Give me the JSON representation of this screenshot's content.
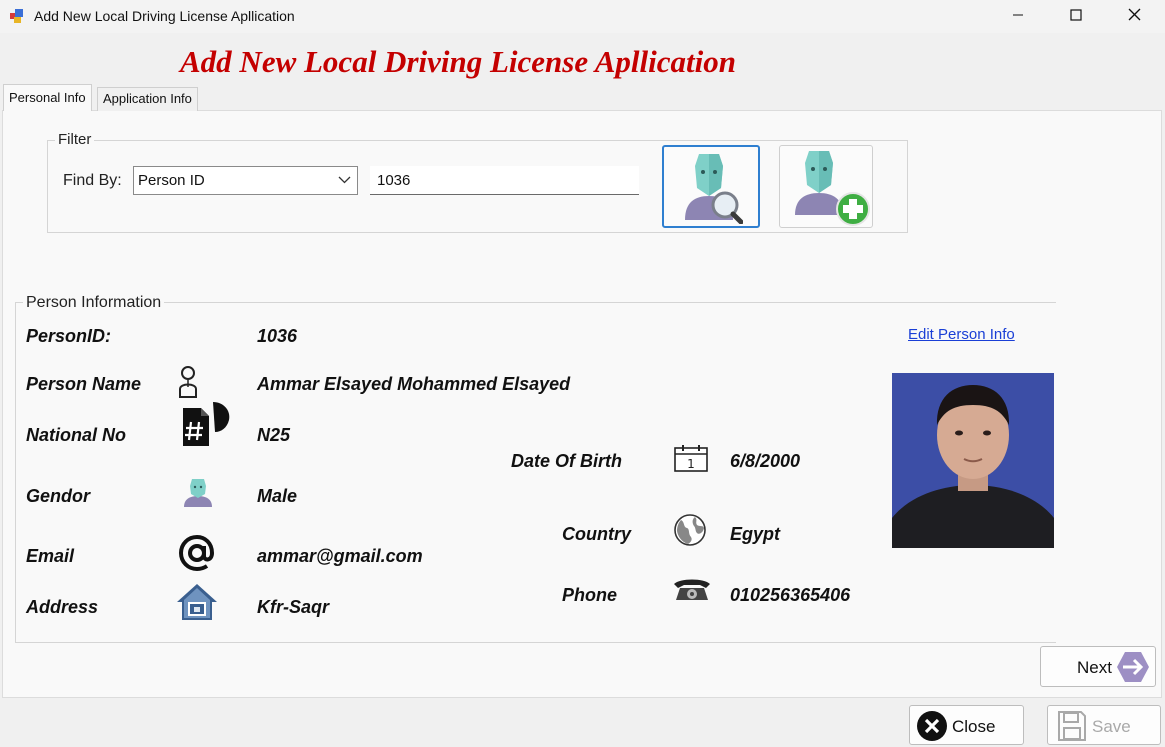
{
  "window": {
    "title": "Add New Local Driving License Apllication",
    "app_icon": "form-icon",
    "minimize_icon": "minimize-icon",
    "maximize_icon": "maximize-icon",
    "close_icon": "close-icon"
  },
  "header": {
    "title": "Add New Local Driving License Apllication",
    "color": "#c40000"
  },
  "tabs": [
    {
      "label": "Personal Info",
      "active": true
    },
    {
      "label": "Application Info",
      "active": false
    }
  ],
  "filter": {
    "legend": "Filter",
    "find_by_label": "Find By:",
    "find_by_value": "Person ID",
    "search_value": "1036",
    "search_button_icon": "person-search-icon",
    "add_button_icon": "person-add-icon"
  },
  "person": {
    "legend": "Person Information",
    "edit_link": "Edit Person Info",
    "person_id_label": "PersonID:",
    "person_id": "1036",
    "name_label": "Person Name",
    "name": "Ammar Elsayed Mohammed Elsayed",
    "national_no_label": "National No",
    "national_no": "N25",
    "gender_label": "Gendor",
    "gender": "Male",
    "email_label": "Email",
    "email": "ammar@gmail.com",
    "address_label": "Address",
    "address": "Kfr-Saqr",
    "dob_label": "Date Of Birth",
    "dob": "6/8/2000",
    "country_label": "Country",
    "country": "Egypt",
    "phone_label": "Phone",
    "phone": "010256365406",
    "icons": [
      "person-icon",
      "national-id-icon",
      "gender-male-icon",
      "at-sign-icon",
      "home-icon",
      "calendar-icon",
      "globe-icon",
      "telephone-icon"
    ],
    "photo": "person-photo"
  },
  "buttons": {
    "next": "Next",
    "close": "Close",
    "save": "Save"
  },
  "colors": {
    "accent_blue": "#2f7fd0",
    "link": "#1a3fd6"
  }
}
